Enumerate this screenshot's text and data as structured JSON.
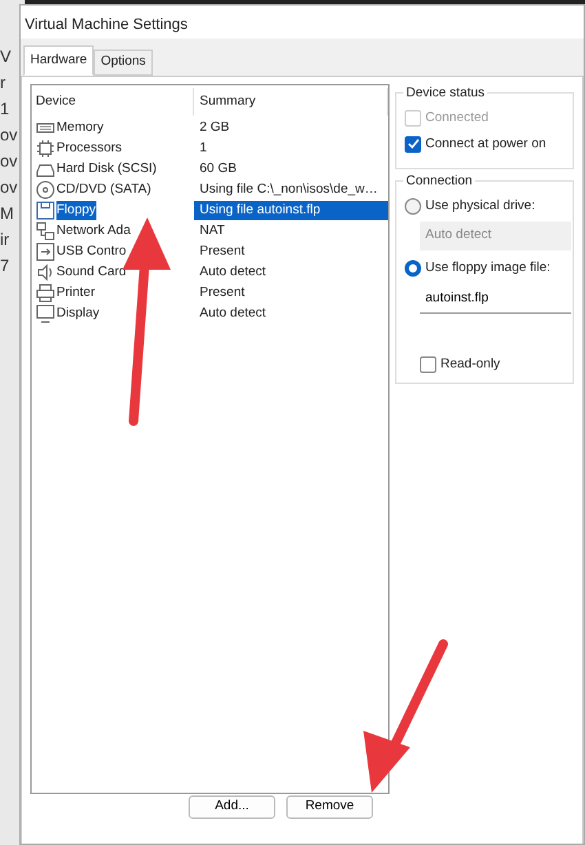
{
  "background_fragments": [
    "V",
    "r",
    "1",
    "ov",
    "ov",
    "ov",
    "M",
    "ir",
    "7"
  ],
  "window": {
    "title": "Virtual Machine Settings"
  },
  "tabs": [
    {
      "label": "Hardware",
      "selected": true
    },
    {
      "label": "Options",
      "selected": false
    }
  ],
  "device_list": {
    "columns": [
      "Device",
      "Summary"
    ],
    "rows": [
      {
        "kind": "memory",
        "device": "Memory",
        "summary": "2 GB",
        "selected": false
      },
      {
        "kind": "cpu",
        "device": "Processors",
        "summary": "1",
        "selected": false
      },
      {
        "kind": "disk",
        "device": "Hard Disk (SCSI)",
        "summary": "60 GB",
        "selected": false
      },
      {
        "kind": "cd",
        "device": "CD/DVD (SATA)",
        "summary": "Using file C:\\_non\\isos\\de_w…",
        "selected": false
      },
      {
        "kind": "floppy",
        "device": "Floppy",
        "summary": "Using file autoinst.flp",
        "selected": true
      },
      {
        "kind": "network",
        "device": "Network Ada",
        "summary": "NAT",
        "selected": false
      },
      {
        "kind": "usb",
        "device": "USB Contro",
        "summary": "Present",
        "selected": false
      },
      {
        "kind": "sound",
        "device": "Sound Card",
        "summary": "Auto detect",
        "selected": false
      },
      {
        "kind": "printer",
        "device": "Printer",
        "summary": "Present",
        "selected": false
      },
      {
        "kind": "display",
        "device": "Display",
        "summary": "Auto detect",
        "selected": false
      }
    ]
  },
  "device_status": {
    "title": "Device status",
    "options": [
      {
        "label": "Connected",
        "checked": false,
        "disabled": true
      },
      {
        "label": "Connect at power on",
        "checked": true,
        "disabled": false
      }
    ]
  },
  "connection": {
    "title": "Connection",
    "options": [
      {
        "label": "Use physical drive:",
        "selected": false,
        "field": "Auto detect",
        "disabled": true
      },
      {
        "label": "Use floppy image file:",
        "selected": true,
        "field": "autoinst.flp",
        "disabled": false
      }
    ],
    "read_only": {
      "label": "Read-only",
      "checked": false
    }
  },
  "buttons": [
    "Add...",
    "Remove"
  ]
}
